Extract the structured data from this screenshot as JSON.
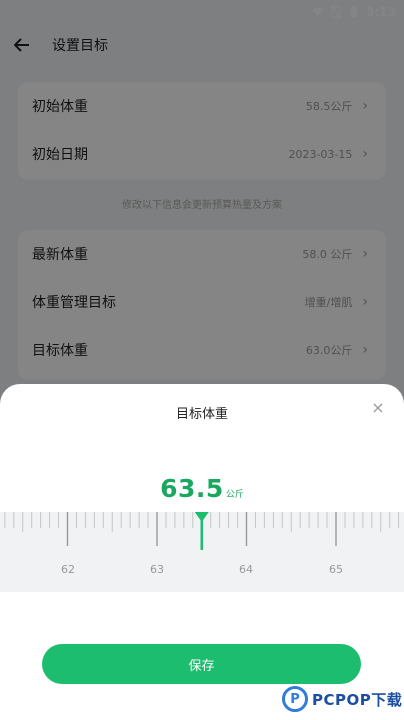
{
  "status_bar": {
    "time": "3:13"
  },
  "app_bar": {
    "title": "设置目标"
  },
  "card1": {
    "rows": [
      {
        "label": "初始体重",
        "value": "58.5公斤"
      },
      {
        "label": "初始日期",
        "value": "2023-03-15"
      }
    ]
  },
  "hint": "修改以下信息会更新预算热量及方案",
  "card2": {
    "rows": [
      {
        "label": "最新体重",
        "value": "58.0 公斤"
      },
      {
        "label": "体重管理目标",
        "value": "增重/增肌"
      },
      {
        "label": "目标体重",
        "value": "63.0公斤"
      }
    ]
  },
  "sheet": {
    "title": "目标体重",
    "close": "×",
    "value": "63.5",
    "unit": "公斤",
    "ruler_labels": [
      "62",
      "63",
      "64",
      "65"
    ],
    "save_label": "保存"
  },
  "colors": {
    "accent": "#1dbd6f",
    "value_text": "#1aa860"
  },
  "watermark": {
    "text": "PCPOP下载",
    "logo_letter": "P"
  }
}
